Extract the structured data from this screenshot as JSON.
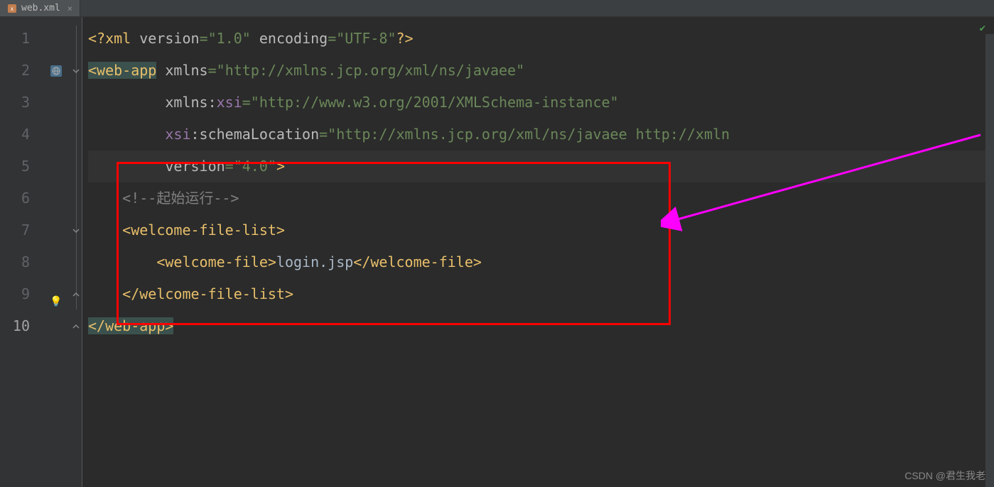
{
  "tab": {
    "filename": "web.xml",
    "close": "×"
  },
  "gutter": {
    "lines": [
      "1",
      "2",
      "3",
      "4",
      "5",
      "6",
      "7",
      "8",
      "9",
      "10"
    ],
    "active_line": 10
  },
  "code": {
    "line1": {
      "prolog_open": "<?",
      "xml": "xml ",
      "version_attr": "version",
      "eq": "=",
      "version_val": "\"1.0\"",
      "space": " ",
      "encoding_attr": "encoding",
      "encoding_val": "\"UTF-8\"",
      "prolog_close": "?>"
    },
    "line2": {
      "open": "<",
      "tag": "web-app",
      "space": " ",
      "xmlns": "xmlns",
      "eq": "=",
      "xmlns_val": "\"http://xmlns.jcp.org/xml/ns/javaee\""
    },
    "line3": {
      "indent": "         ",
      "xmlns": "xmlns:",
      "xsi": "xsi",
      "eq": "=",
      "val": "\"http://www.w3.org/2001/XMLSchema-instance\""
    },
    "line4": {
      "indent": "         ",
      "xsi": "xsi",
      "colon": ":",
      "schema": "schemaLocation",
      "eq": "=",
      "val": "\"http://xmlns.jcp.org/xml/ns/javaee http://xmln"
    },
    "line5": {
      "indent": "         ",
      "version": "version",
      "eq": "=",
      "val": "\"4.0\"",
      "close": ">"
    },
    "line6": {
      "indent": "    ",
      "comment": "<!--起始运行-->"
    },
    "line7": {
      "indent": "    ",
      "open": "<",
      "tag": "welcome-file-list",
      "close": ">"
    },
    "line8": {
      "indent": "        ",
      "open": "<",
      "tag": "welcome-file",
      "close": ">",
      "text": "login.jsp",
      "open2": "</",
      "tag2": "welcome-file",
      "close2": ">"
    },
    "line9": {
      "indent": "    ",
      "open": "</",
      "tag": "welcome-file-list",
      "close": ">"
    },
    "line10": {
      "open": "</",
      "tag": "web-app",
      "close": ">"
    }
  },
  "watermark": "CSDN @君生我老"
}
